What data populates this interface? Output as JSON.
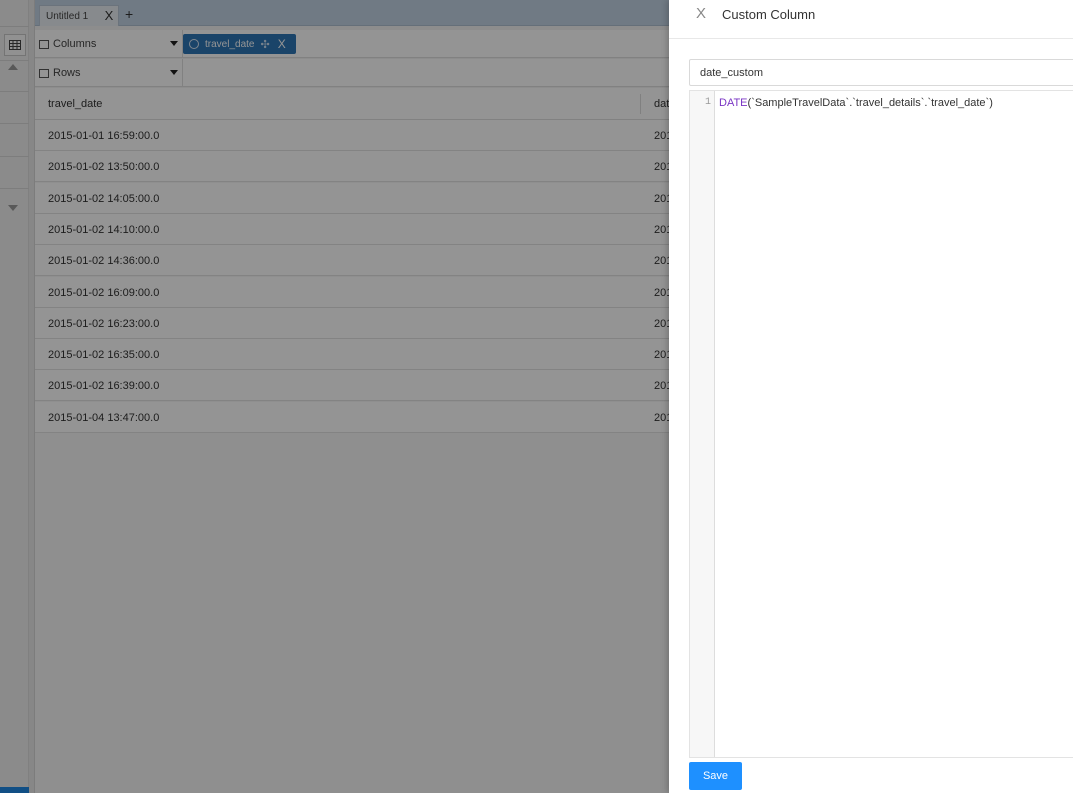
{
  "tabs": [
    {
      "label": "Untitled 1",
      "close_icon": "close-icon"
    }
  ],
  "tab_add_label": "+",
  "shelves": {
    "columns": {
      "label": "Columns",
      "icon": "columns-icon"
    },
    "rows": {
      "label": "Rows",
      "icon": "rows-icon"
    },
    "column_pill": {
      "label": "travel_date",
      "icons": [
        "check-circle-icon",
        "move-icon",
        "close-icon"
      ],
      "move_glyph": "✣",
      "close_glyph": "X"
    }
  },
  "table": {
    "headers": [
      "travel_date",
      "dat"
    ],
    "rows": [
      [
        "2015-01-01 16:59:00.0",
        "201"
      ],
      [
        "2015-01-02 13:50:00.0",
        "201"
      ],
      [
        "2015-01-02 14:05:00.0",
        "201"
      ],
      [
        "2015-01-02 14:10:00.0",
        "201"
      ],
      [
        "2015-01-02 14:36:00.0",
        "201"
      ],
      [
        "2015-01-02 16:09:00.0",
        "201"
      ],
      [
        "2015-01-02 16:23:00.0",
        "201"
      ],
      [
        "2015-01-02 16:35:00.0",
        "201"
      ],
      [
        "2015-01-02 16:39:00.0",
        "201"
      ],
      [
        "2015-01-04 13:47:00.0",
        "201"
      ]
    ]
  },
  "drawer": {
    "title": "Custom Column",
    "close_glyph": "X",
    "name_value": "date_custom",
    "editor": {
      "line_number": "1",
      "function_name": "DATE",
      "arguments": "(`SampleTravelData`.`travel_details`.`travel_date`)"
    },
    "save_label": "Save"
  },
  "colors": {
    "accent": "#1e90ff",
    "pill": "#2e75b6",
    "tabbar": "#c2d3e4",
    "function_keyword": "#7a35c4"
  }
}
